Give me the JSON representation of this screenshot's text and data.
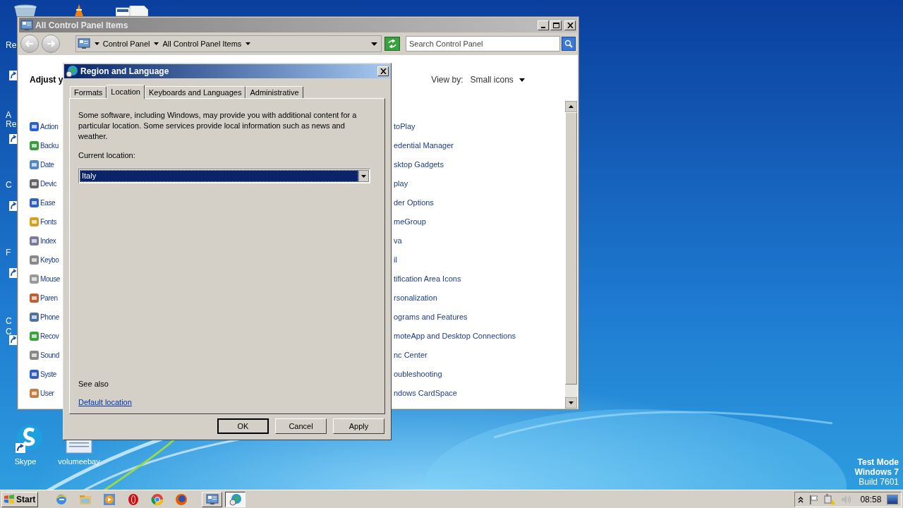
{
  "desktop": {
    "side_labels": [
      "Re",
      "A",
      "Re",
      "C",
      "F",
      "C",
      "C"
    ],
    "bottom_icons": [
      {
        "kind": "skype",
        "label": "Skype"
      },
      {
        "kind": "document",
        "label": "volumeebay"
      }
    ],
    "test_mode": [
      "Test Mode",
      "Windows 7",
      "Build 7601"
    ]
  },
  "control_panel": {
    "title": "All Control Panel Items",
    "breadcrumbs": [
      "Control Panel",
      "All Control Panel Items"
    ],
    "search": {
      "placeholder": "Search Control Panel"
    },
    "heading": "Adjust y",
    "view_by_label": "View by:",
    "view_by_value": "Small icons",
    "left_items": [
      "Action",
      "Backu",
      "Date",
      "Devic",
      "Ease",
      "Fonts",
      "Index",
      "Keybo",
      "Mouse",
      "Paren",
      "Phone",
      "Recov",
      "Sound",
      "Syste",
      "User"
    ],
    "right_items": [
      "toPlay",
      "edential Manager",
      "sktop Gadgets",
      "play",
      "der Options",
      "meGroup",
      "va",
      "il",
      "tification Area Icons",
      "rsonalization",
      "ograms and Features",
      "moteApp and Desktop Connections",
      "nc Center",
      "oubleshooting",
      "ndows CardSpace"
    ]
  },
  "dialog": {
    "title": "Region and Language",
    "tabs": [
      {
        "label": "Formats",
        "selected": false
      },
      {
        "label": "Location",
        "selected": true
      },
      {
        "label": "Keyboards and Languages",
        "selected": false
      },
      {
        "label": "Administrative",
        "selected": false
      }
    ],
    "description": "Some software, including Windows, may provide you with additional content for a particular location. Some services provide local information such as news and weather.",
    "current_location_label": "Current location:",
    "location_value": "Italy",
    "see_also": "See also",
    "default_location_link": "Default location",
    "buttons": [
      {
        "label": "OK",
        "default": true
      },
      {
        "label": "Cancel",
        "default": false
      },
      {
        "label": "Apply",
        "default": false
      }
    ]
  },
  "taskbar": {
    "start": "Start",
    "quick_launch": [
      {
        "kind": "browser"
      },
      {
        "kind": "folder"
      },
      {
        "kind": "player"
      },
      {
        "kind": "ring"
      },
      {
        "kind": "wheel"
      },
      {
        "kind": "globe"
      }
    ],
    "windows": [
      {
        "kind": "panel",
        "selected": false
      },
      {
        "kind": "region",
        "selected": true
      }
    ],
    "clock": "08:58"
  }
}
